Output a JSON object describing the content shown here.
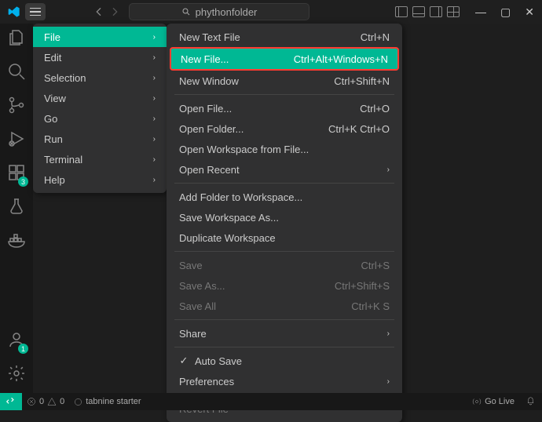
{
  "search": {
    "placeholder": "phythonfolder"
  },
  "menubar": {
    "items": [
      {
        "label": "File",
        "active": true
      },
      {
        "label": "Edit"
      },
      {
        "label": "Selection"
      },
      {
        "label": "View"
      },
      {
        "label": "Go"
      },
      {
        "label": "Run"
      },
      {
        "label": "Terminal"
      },
      {
        "label": "Help"
      }
    ]
  },
  "submenu": {
    "newTextFile": {
      "label": "New Text File",
      "shortcut": "Ctrl+N"
    },
    "newFile": {
      "label": "New File...",
      "shortcut": "Ctrl+Alt+Windows+N"
    },
    "newWindow": {
      "label": "New Window",
      "shortcut": "Ctrl+Shift+N"
    },
    "openFile": {
      "label": "Open File...",
      "shortcut": "Ctrl+O"
    },
    "openFolder": {
      "label": "Open Folder...",
      "shortcut": "Ctrl+K Ctrl+O"
    },
    "openWorkspace": {
      "label": "Open Workspace from File..."
    },
    "openRecent": {
      "label": "Open Recent"
    },
    "addFolder": {
      "label": "Add Folder to Workspace..."
    },
    "saveWorkspaceAs": {
      "label": "Save Workspace As..."
    },
    "dupWorkspace": {
      "label": "Duplicate Workspace"
    },
    "save": {
      "label": "Save",
      "shortcut": "Ctrl+S"
    },
    "saveAs": {
      "label": "Save As...",
      "shortcut": "Ctrl+Shift+S"
    },
    "saveAll": {
      "label": "Save All",
      "shortcut": "Ctrl+K S"
    },
    "share": {
      "label": "Share"
    },
    "autoSave": {
      "label": "Auto Save"
    },
    "preferences": {
      "label": "Preferences"
    },
    "revert": {
      "label": "Revert File"
    }
  },
  "activitybar": {
    "badges": {
      "extensions": "3",
      "account": "1"
    }
  },
  "statusbar": {
    "errors": "0",
    "warnings": "0",
    "tabnine": "tabnine starter",
    "golive": "Go Live"
  }
}
